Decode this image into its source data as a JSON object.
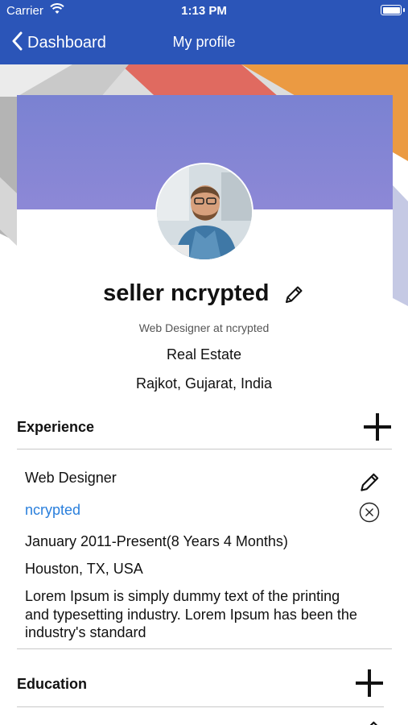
{
  "status_bar": {
    "carrier": "Carrier",
    "time": "1:13 PM"
  },
  "nav": {
    "back_label": "Dashboard",
    "title": "My profile"
  },
  "profile": {
    "name": "seller ncrypted",
    "headline": "Web Designer at ncrypted",
    "industry": "Real Estate",
    "location": "Rajkot, Gujarat, India"
  },
  "sections": {
    "experience_title": "Experience",
    "education_title": "Education"
  },
  "experience": {
    "title": "Web Designer",
    "company": "ncrypted",
    "period": "January 2011-Present(8 Years 4 Months)",
    "location": "Houston, TX, USA",
    "description": "Lorem Ipsum is simply dummy text of the printing and typesetting industry. Lorem Ipsum has been the industry's standard"
  },
  "colors": {
    "nav_bg": "#2b55b8",
    "link": "#2a7fdc",
    "cover": "#7f86d4"
  }
}
